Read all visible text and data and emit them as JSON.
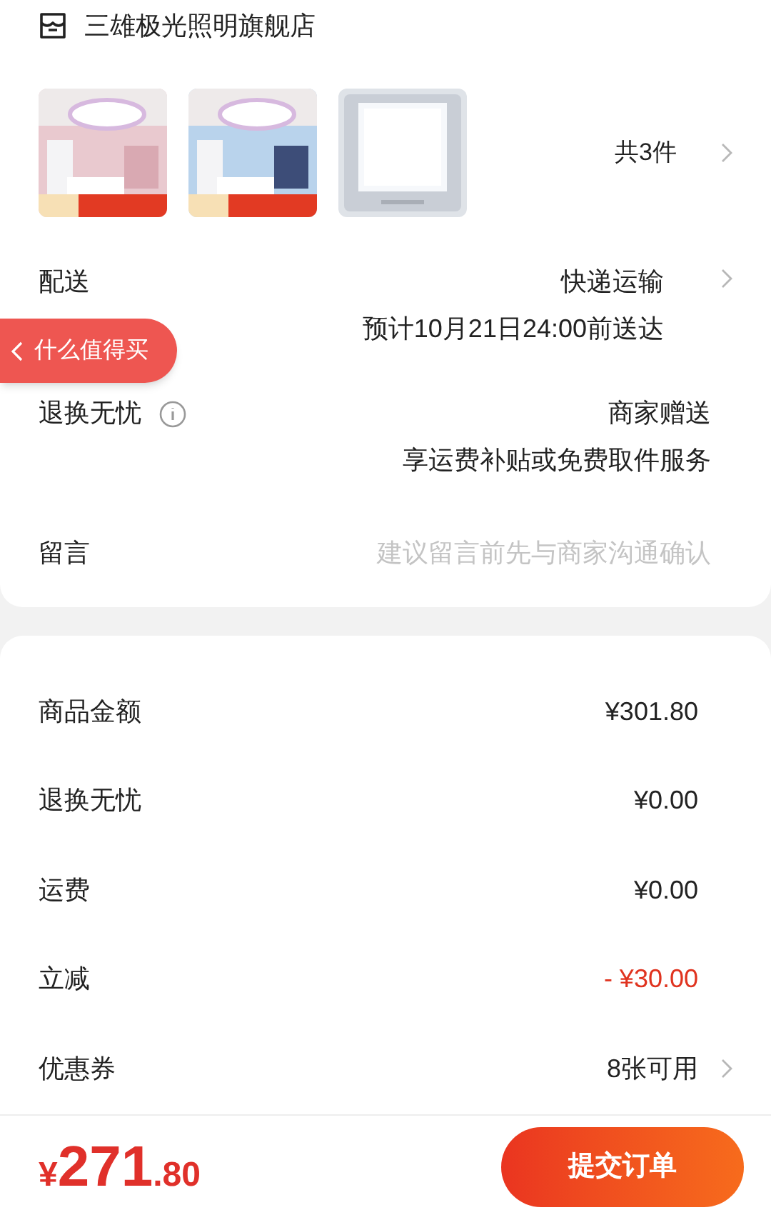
{
  "store": {
    "name": "三雄极光照明旗舰店"
  },
  "products": {
    "count": "共3件"
  },
  "details": [
    {
      "label": "配送",
      "info": false,
      "chevron": true,
      "lines": [
        "快递运输",
        "预计10月21日24:00前送达"
      ]
    },
    {
      "label": "退换无忧",
      "info": true,
      "chevron": false,
      "lines": [
        "商家赠送",
        "享运费补贴或免费取件服务"
      ]
    }
  ],
  "message": {
    "label": "留言",
    "placeholder": "建议留言前先与商家沟通确认"
  },
  "summary": [
    {
      "label": "商品金额",
      "value": "¥301.80",
      "highlight": false,
      "chevron": false
    },
    {
      "label": "退换无忧",
      "value": "¥0.00",
      "highlight": false,
      "chevron": false
    },
    {
      "label": "运费",
      "value": "¥0.00",
      "highlight": false,
      "chevron": false
    },
    {
      "label": "立减",
      "value": "- ¥30.00",
      "highlight": true,
      "chevron": false
    },
    {
      "label": "优惠券",
      "value": "8张可用",
      "highlight": false,
      "chevron": true
    }
  ],
  "floating": {
    "label": "什么值得买"
  },
  "footer": {
    "currency": "¥",
    "integer": "271",
    "decimal": ".80",
    "button": "提交订单"
  }
}
